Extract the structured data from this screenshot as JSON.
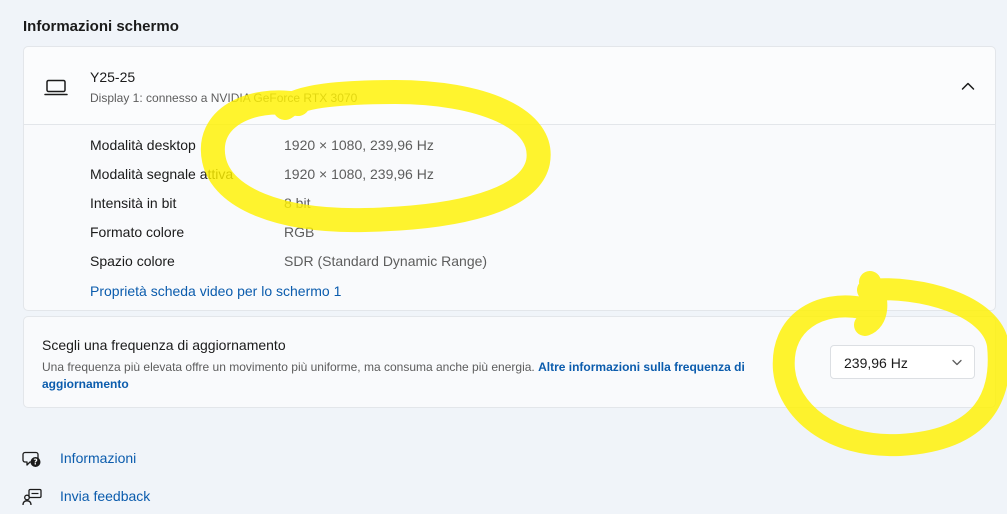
{
  "section": {
    "title": "Informazioni schermo"
  },
  "display": {
    "name": "Y25-25",
    "subtitle": "Display 1: connesso a NVIDIA GeForce RTX 3070",
    "info": [
      {
        "label": "Modalità desktop",
        "value": "1920 × 1080, 239,96 Hz"
      },
      {
        "label": "Modalità segnale attiva",
        "value": "1920 × 1080, 239,96 Hz"
      },
      {
        "label": "Intensità in bit",
        "value": "8 bit"
      },
      {
        "label": "Formato colore",
        "value": "RGB"
      },
      {
        "label": "Spazio colore",
        "value": "SDR (Standard Dynamic Range)"
      }
    ],
    "adapter_link": "Proprietà scheda video per lo schermo 1"
  },
  "refresh": {
    "title": "Scegli una frequenza di aggiornamento",
    "description": "Una frequenza più elevata offre un movimento più uniforme, ma consuma anche più energia.",
    "more_info_link": "Altre informazioni sulla frequenza di aggiornamento",
    "selected_rate": "239,96 Hz"
  },
  "footer_links": {
    "info": "Informazioni",
    "feedback": "Invia feedback"
  },
  "icons": {
    "display": "monitor-icon",
    "collapse": "chevron-up-icon",
    "dropdown": "chevron-down-icon",
    "info": "help-icon",
    "feedback": "feedback-icon"
  },
  "colors": {
    "accent_link": "#0b5cad",
    "highlight": "#fff200"
  }
}
